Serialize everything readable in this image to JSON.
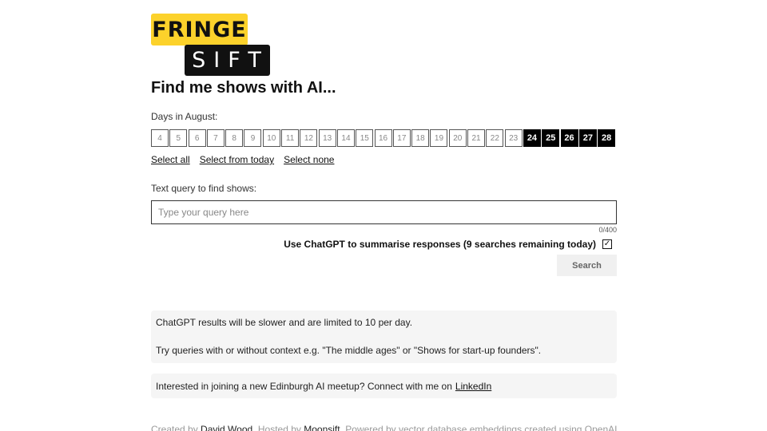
{
  "logo": {
    "top": "FRINGE",
    "bottom": "SIFT"
  },
  "heading": "Find me shows with AI...",
  "days": {
    "label": "Days in August:",
    "items": [
      {
        "n": "4",
        "selected": false
      },
      {
        "n": "5",
        "selected": false
      },
      {
        "n": "6",
        "selected": false
      },
      {
        "n": "7",
        "selected": false
      },
      {
        "n": "8",
        "selected": false
      },
      {
        "n": "9",
        "selected": false
      },
      {
        "n": "10",
        "selected": false
      },
      {
        "n": "11",
        "selected": false
      },
      {
        "n": "12",
        "selected": false
      },
      {
        "n": "13",
        "selected": false
      },
      {
        "n": "14",
        "selected": false
      },
      {
        "n": "15",
        "selected": false
      },
      {
        "n": "16",
        "selected": false
      },
      {
        "n": "17",
        "selected": false
      },
      {
        "n": "18",
        "selected": false
      },
      {
        "n": "19",
        "selected": false
      },
      {
        "n": "20",
        "selected": false
      },
      {
        "n": "21",
        "selected": false
      },
      {
        "n": "22",
        "selected": false
      },
      {
        "n": "23",
        "selected": false
      },
      {
        "n": "24",
        "selected": true
      },
      {
        "n": "25",
        "selected": true
      },
      {
        "n": "26",
        "selected": true
      },
      {
        "n": "27",
        "selected": true
      },
      {
        "n": "28",
        "selected": true
      }
    ],
    "select_all": "Select all",
    "select_from_today": "Select from today",
    "select_none": "Select none"
  },
  "query": {
    "label": "Text query to find shows:",
    "placeholder": "Type your query here",
    "value": "",
    "counter": "0/400"
  },
  "chatgpt": {
    "label": "Use ChatGPT to summarise responses (9 searches remaining today)",
    "checked": true,
    "check_glyph": "✓"
  },
  "search_button": "Search",
  "info": {
    "line1": "ChatGPT results will be slower and are limited to 10 per day.",
    "line2": "Try queries with or without context e.g. \"The middle ages\" or \"Shows for start-up founders\"."
  },
  "meetup": {
    "text": "Interested in joining a new Edinburgh AI meetup? Connect with me on",
    "link": "LinkedIn"
  },
  "footer": {
    "created_by": "Created by",
    "author": "David Wood",
    "hosted_by": ". Hosted by",
    "host": "Moonsift",
    "powered": ". Powered by vector database embeddings created using OpenAI"
  }
}
